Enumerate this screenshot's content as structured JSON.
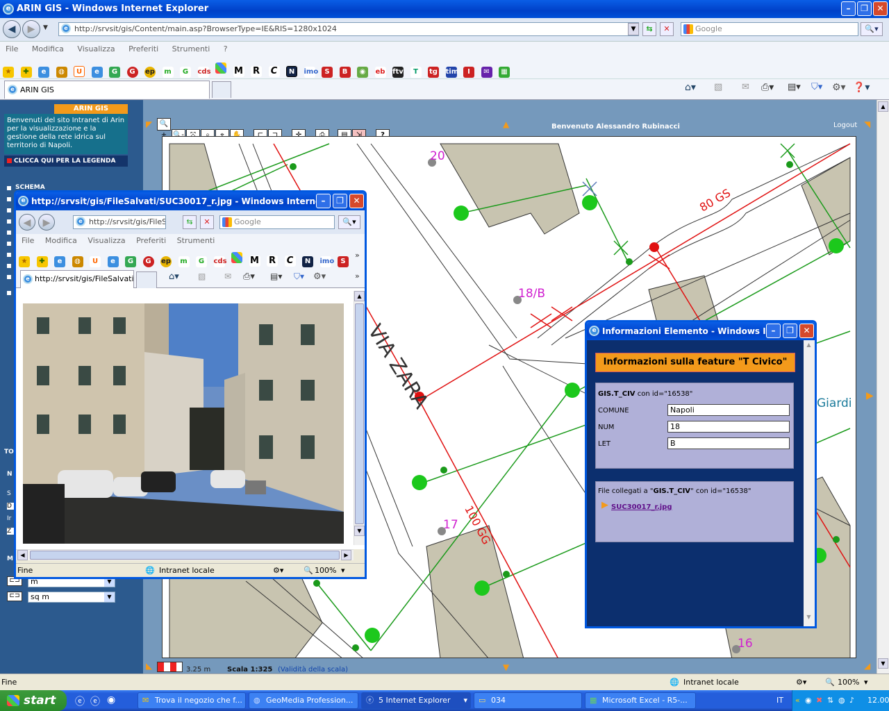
{
  "ie": {
    "title": "ARIN GIS - Windows Internet Explorer",
    "address": "http://srvsit/gis/Content/main.asp?BrowserType=IE&RIS=1280x1024",
    "search_placeholder": "Google",
    "menu": [
      "File",
      "Modifica",
      "Visualizza",
      "Preferiti",
      "Strumenti",
      "?"
    ],
    "tab_label": "ARIN GIS",
    "status_left": "Fine",
    "status_zone": "Intranet locale",
    "zoom": "100%"
  },
  "gis": {
    "logo": "ARIN GIS",
    "welcome_text": "Benvenuti del sito Intranet di Arin per la visualizzazione e la gestione della rete idrica sul territorio di Napoli.",
    "legend_link": "CLICCA QUI PER LA LEGENDA",
    "user_greeting": "Benvenuto Alessandro Rubinacci",
    "logout": "Logout",
    "scale_dist": "3.25 m",
    "scale_label": "Scala 1:325",
    "scale_validity": "(Validità della scala)",
    "unit_length": "m",
    "unit_area": "sq m",
    "left_partial_1": "SCHEMA",
    "left_partial_2": "TO",
    "left_partial_3": "N",
    "left_partial_4": "S",
    "left_partial_5": "D",
    "left_partial_6": "Ir",
    "left_partial_7": "Z",
    "left_partial_8": "M"
  },
  "map": {
    "street": "VIA ZARA",
    "pipe1": "80 GS",
    "pipe2": "100 GG",
    "num_20": "20",
    "num_18b": "18/B",
    "num_17": "17",
    "num_16": "16",
    "giardi": "Giardi"
  },
  "photo_window": {
    "title": "http://srvsit/gis/FileSalvati/SUC30017_r.jpg - Windows Interne...",
    "address": "http://srvsit/gis/FileSa",
    "search_placeholder": "Google",
    "menu": [
      "File",
      "Modifica",
      "Visualizza",
      "Preferiti",
      "Strumenti"
    ],
    "tab_label": "http://srvsit/gis/FileSalvati...",
    "status_left": "Fine",
    "status_zone": "Intranet locale",
    "zoom": "100%"
  },
  "info_window": {
    "title": "Informazioni Elemento - Windows I...",
    "header": "Informazioni sulla feature \"T Civico\"",
    "feature_line_bold": "GIS.T_CIV",
    "feature_line_rest": " con id=\"16538\"",
    "fields": [
      {
        "label": "COMUNE",
        "value": "Napoli"
      },
      {
        "label": "NUM",
        "value": "18"
      },
      {
        "label": "LET",
        "value": "B"
      }
    ],
    "files_prefix": "File collegati a \"",
    "files_bold": "GIS.T_CIV",
    "files_suffix": "\" con id=\"16538\"",
    "file_link": "SUC30017_r.jpg"
  },
  "taskbar": {
    "start": "start",
    "tasks": [
      "Trova il negozio che f...",
      "GeoMedia Profession...",
      "5 Internet Explorer",
      "034",
      "Microsoft Excel - R5-..."
    ],
    "lang": "IT",
    "clock": "12.00"
  },
  "colors": {
    "accent_orange": "#f39a1b",
    "pipe_red": "#e01010",
    "pipe_green": "#1a9a1a",
    "label_magenta": "#d020d0"
  }
}
